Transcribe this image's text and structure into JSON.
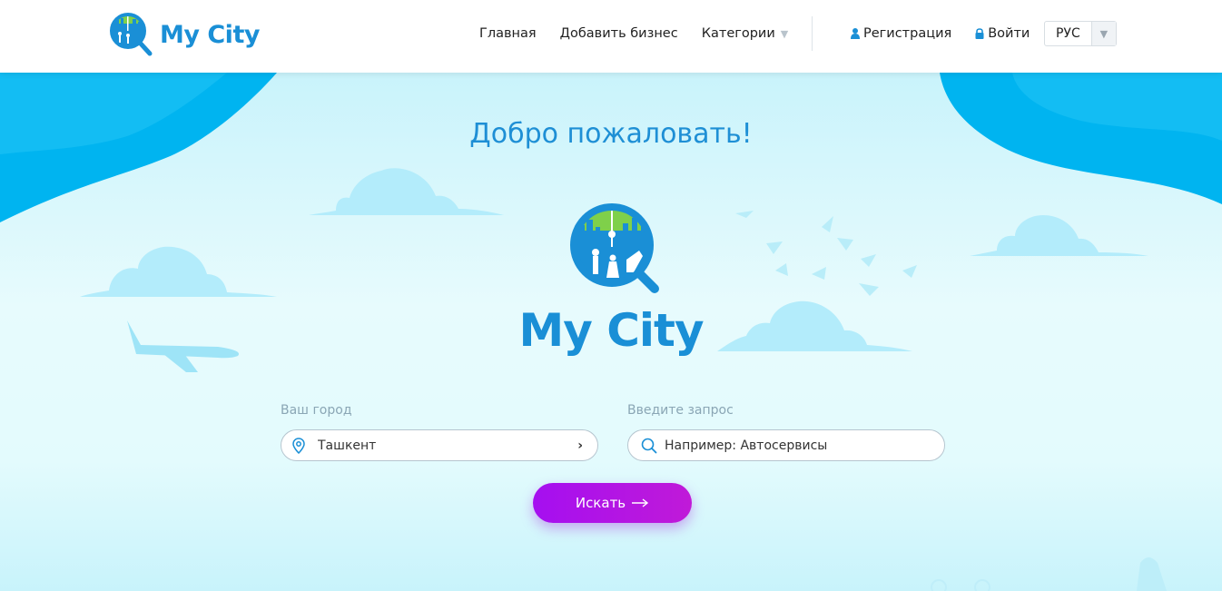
{
  "brand": {
    "name": "My City"
  },
  "nav": {
    "home": "Главная",
    "add_business": "Добавить бизнес",
    "categories": "Категории",
    "register": "Регистрация",
    "login": "Войти",
    "language": "РУС"
  },
  "hero": {
    "welcome": "Добро пожаловать!",
    "logo_title": "My City"
  },
  "search": {
    "city_label": "Ваш город",
    "city_value": "Ташкент",
    "query_label": "Введите запрос",
    "query_placeholder": "Например: Автосервисы",
    "button_label": "Искать"
  },
  "colors": {
    "brand_blue": "#1a8fd6",
    "accent_purple": "#a50ff0",
    "hero_blue": "#00b4f0",
    "cloud": "#b3ecfb"
  },
  "icons": [
    "my-city-logo-icon",
    "chevron-down-icon",
    "person-icon",
    "lock-icon",
    "map-pin-icon",
    "chevron-right-icon",
    "search-icon",
    "arrow-right-icon",
    "airplane-icon",
    "bird-icon",
    "cloud-icon"
  ]
}
